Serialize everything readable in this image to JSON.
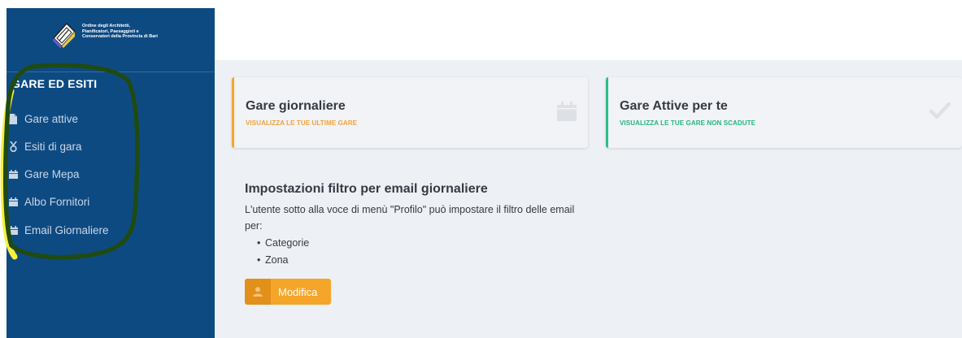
{
  "brand": {
    "logo_lines": [
      "Ordine degli Architetti,",
      "Pianificatori, Paesaggisti e",
      "Conservatori della Provincia di Bari"
    ]
  },
  "sidebar": {
    "section_title": "GARE ED ESITI",
    "items": [
      {
        "label": "Gare attive",
        "icon": "file-icon"
      },
      {
        "label": "Esiti di gara",
        "icon": "medal-icon"
      },
      {
        "label": "Gare Mepa",
        "icon": "calendar-icon"
      },
      {
        "label": "Albo Fornitori",
        "icon": "calendar-icon"
      },
      {
        "label": "Email Giornaliere",
        "icon": "calendar-icon"
      }
    ]
  },
  "cards": [
    {
      "title": "Gare giornaliere",
      "subtitle": "VISUALIZZA LE TUE ULTIME GARE",
      "icon": "calendar-icon",
      "accent": "#f5a52a"
    },
    {
      "title": "Gare Attive per te",
      "subtitle": "VISUALIZZA LE TUE GARE NON SCADUTE",
      "icon": "check-icon",
      "accent": "#2dbd86"
    }
  ],
  "settings": {
    "title": "Impostazioni filtro per email giornaliere",
    "description": "L'utente sotto alla voce di menù \"Profilo\" può impostare il filtro delle email per:",
    "options": [
      "Categorie",
      "Zona"
    ],
    "button_label": "Modifica",
    "button_icon": "user-icon"
  },
  "colors": {
    "sidebar_bg": "#0e4a82",
    "main_bg": "#edf0f4",
    "orange": "#f5a52a",
    "green": "#2dbd86",
    "annotation_yellow": "#f6f03a",
    "annotation_green": "#1f4a14"
  }
}
